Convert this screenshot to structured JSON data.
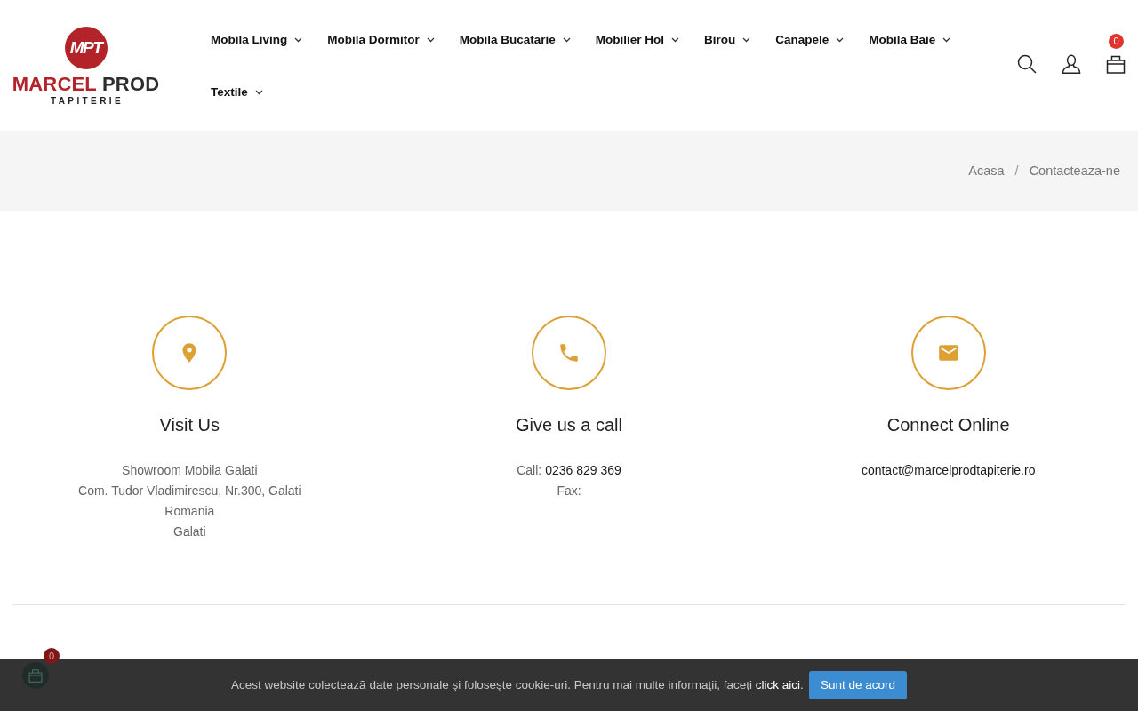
{
  "logo": {
    "monogram": "MPT",
    "name_first": "MARCEL",
    "name_second": "PROD",
    "tagline": "TAPITERIE"
  },
  "nav": [
    {
      "label": "Mobila Living",
      "has_dropdown": true
    },
    {
      "label": "Mobila Dormitor",
      "has_dropdown": true
    },
    {
      "label": "Mobila Bucatarie",
      "has_dropdown": true
    },
    {
      "label": "Mobilier Hol",
      "has_dropdown": true
    },
    {
      "label": "Birou",
      "has_dropdown": true
    },
    {
      "label": "Canapele",
      "has_dropdown": true
    },
    {
      "label": "Mobila Baie",
      "has_dropdown": true
    },
    {
      "label": "Textile",
      "has_dropdown": true
    }
  ],
  "header_actions": {
    "cart_count": "0"
  },
  "breadcrumb": {
    "separator": "/",
    "items": [
      "Acasa",
      "Contacteaza-ne"
    ]
  },
  "contact_cards": [
    {
      "kind": "location",
      "title": "Visit Us",
      "lines": [
        {
          "text": "Showroom Mobila Galati"
        },
        {
          "text": "Com. Tudor Vladimirescu, Nr.300, Galati"
        },
        {
          "text": "Romania"
        },
        {
          "text": "Galati"
        }
      ]
    },
    {
      "kind": "phone",
      "title": "Give us a call",
      "lines": [
        {
          "text": "Call:",
          "value": "0236 829 369"
        },
        {
          "text": "Fax:"
        }
      ]
    },
    {
      "kind": "email",
      "title": "Connect Online",
      "lines": [
        {
          "value": "contact@marcelprodtapiterie.ro"
        }
      ]
    }
  ],
  "floating_cart": {
    "count": "0"
  },
  "cookie_banner": {
    "text": "Acest website colectează date personale şi foloseşte cookie-uri. Pentru mai multe informaţii, faceţi",
    "link": "click aici",
    "after_link": ".",
    "button": "Sunt de acord"
  }
}
